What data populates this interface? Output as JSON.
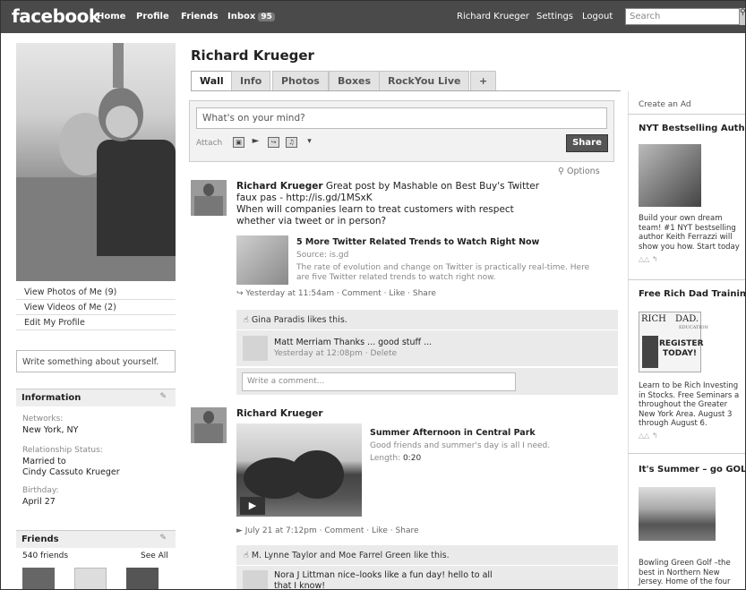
{
  "topbar": {
    "logo": "facebook",
    "nav": [
      "Home",
      "Profile",
      "Friends",
      "Inbox"
    ],
    "inbox_count": "95",
    "user_name": "Richard Krueger",
    "settings": "Settings",
    "logout": "Logout",
    "search_placeholder": "Search"
  },
  "profile": {
    "name": "Richard Krueger",
    "tabs": [
      "Wall",
      "Info",
      "Photos",
      "Boxes",
      "RockYou Live",
      "+"
    ]
  },
  "sidebar": {
    "links": [
      "View Photos of Me (9)",
      "View Videos of Me (2)",
      "Edit My Profile"
    ],
    "write_prompt": "Write something about yourself.",
    "info_header": "Information",
    "info": {
      "networks_label": "Networks:",
      "networks": "New York, NY",
      "rel_label": "Relationship Status:",
      "rel_value": "Married to",
      "rel_person": "Cindy Cassuto Krueger",
      "bday_label": "Birthday:",
      "bday": "April 27"
    },
    "friends_header": "Friends",
    "friends_count": "540 friends",
    "see_all": "See All"
  },
  "publisher": {
    "placeholder": "What's on your mind?",
    "attach": "Attach",
    "share": "Share"
  },
  "feed": {
    "options": "Options",
    "post1": {
      "author": "Richard Krueger",
      "text1": "Great post by Mashable on Best Buy's Twitter",
      "text2": "faux pas - http://is.gd/1MSxK",
      "text3": "When will companies learn to treat customers with respect",
      "text4": "whether via tweet or in person?",
      "link_title": "5 More Twitter Related Trends to Watch Right Now",
      "link_source": "Source: is.gd",
      "link_desc1": "The rate of evolution and change on Twitter is practically real-time. Here",
      "link_desc2": "are five Twitter related trends to watch right now.",
      "meta": "Yesterday at 11:54am · Comment · Like · Share",
      "likes": "Gina Paradis likes this.",
      "comment_author": "Matt Merriam",
      "comment_text": "Thanks ... good stuff ...",
      "comment_meta": "Yesterday at 12:08pm · Delete",
      "comment_placeholder": "Write a comment..."
    },
    "post2": {
      "author": "Richard Krueger",
      "video_title": "Summer Afternoon in Central Park",
      "video_desc": "Good friends and summer's day is all I need.",
      "length_label": "Length:",
      "length": "0:20",
      "meta": "July 21 at 7:12pm · Comment · Like · Share",
      "likes": "M. Lynne Taylor and Moe Farrel Green like this.",
      "comment1": "Nora J Littman nice–looks like a fun day! hello to all",
      "comment2": "that I know!"
    }
  },
  "ads": {
    "create": "Create an Ad",
    "ad1_title": "NYT Bestselling Autho",
    "ad1_body": "Build your own dream\nteam! #1 NYT bestselling\nauthor Keith Ferrazzi will\nshow you how. Start today",
    "ad2_title": "Free Rich Dad Training",
    "ad2_img_line1": "RICH",
    "ad2_img_line2": "DAD.",
    "ad2_img_sub": "EDUCATION",
    "ad2_img_line3": "REGISTER",
    "ad2_img_line4": "TODAY!",
    "ad2_body": "Learn to be Rich Investing\nin Stocks. Free Seminars a\nthroughout the Greater\nNew York Area. August 3\nthrough August 6.",
    "ad3_title": "It's Summer – go GOLF",
    "ad3_body": "Bowling Green Golf –the\nbest in Northern New\nJersey. Home of the four",
    "like_icons": "△△ ↰"
  }
}
